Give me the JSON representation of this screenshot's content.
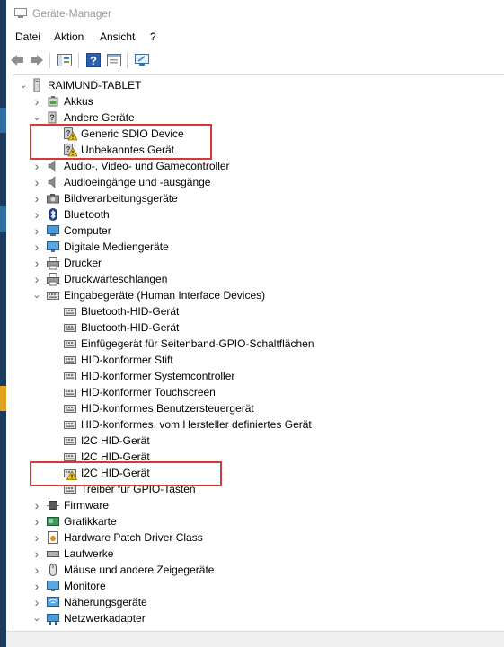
{
  "window": {
    "title": "Geräte-Manager"
  },
  "menu": [
    "Datei",
    "Aktion",
    "Ansicht",
    "?"
  ],
  "toolbar": [
    "back-icon",
    "forward-icon",
    "show-hide-tree-icon",
    "help-icon",
    "properties-icon",
    "monitor-icon"
  ],
  "colors": {
    "highlight": "#d23a3a",
    "chevron": "#666666",
    "warning": "#f2c200"
  },
  "tree": {
    "root": "RAIMUND-TABLET",
    "items": [
      {
        "label": "Akkus",
        "icon": "battery-icon",
        "level": 1,
        "expanded": false
      },
      {
        "label": "Andere Geräte",
        "icon": "other-devices-icon",
        "level": 1,
        "expanded": true
      },
      {
        "label": "Generic SDIO Device",
        "icon": "warning-device-icon",
        "level": 2
      },
      {
        "label": "Unbekanntes Gerät",
        "icon": "warning-device-icon",
        "level": 2
      },
      {
        "label": "Audio-, Video- und Gamecontroller",
        "icon": "speaker-icon",
        "level": 1,
        "expanded": false
      },
      {
        "label": "Audioeingänge und -ausgänge",
        "icon": "speaker-icon",
        "level": 1,
        "expanded": false
      },
      {
        "label": "Bildverarbeitungsgeräte",
        "icon": "camera-icon",
        "level": 1,
        "expanded": false
      },
      {
        "label": "Bluetooth",
        "icon": "bluetooth-icon",
        "level": 1,
        "expanded": false
      },
      {
        "label": "Computer",
        "icon": "computer-icon",
        "level": 1,
        "expanded": false
      },
      {
        "label": "Digitale Mediengeräte",
        "icon": "monitor-icon",
        "level": 1,
        "expanded": false
      },
      {
        "label": "Drucker",
        "icon": "printer-icon",
        "level": 1,
        "expanded": false
      },
      {
        "label": "Druckwarteschlangen",
        "icon": "printer-icon",
        "level": 1,
        "expanded": false
      },
      {
        "label": "Eingabegeräte (Human Interface Devices)",
        "icon": "hid-icon",
        "level": 1,
        "expanded": true
      },
      {
        "label": "Bluetooth-HID-Gerät",
        "icon": "hid-icon",
        "level": 2
      },
      {
        "label": "Bluetooth-HID-Gerät",
        "icon": "hid-icon",
        "level": 2
      },
      {
        "label": "Einfügegerät für Seitenband-GPIO-Schaltflächen",
        "icon": "hid-icon",
        "level": 2
      },
      {
        "label": "HID-konformer Stift",
        "icon": "hid-icon",
        "level": 2
      },
      {
        "label": "HID-konformer Systemcontroller",
        "icon": "hid-icon",
        "level": 2
      },
      {
        "label": "HID-konformer Touchscreen",
        "icon": "hid-icon",
        "level": 2
      },
      {
        "label": "HID-konformes Benutzersteuergerät",
        "icon": "hid-icon",
        "level": 2
      },
      {
        "label": "HID-konformes, vom Hersteller definiertes Gerät",
        "icon": "hid-icon",
        "level": 2
      },
      {
        "label": "I2C HID-Gerät",
        "icon": "hid-icon",
        "level": 2
      },
      {
        "label": "I2C HID-Gerät",
        "icon": "hid-icon",
        "level": 2
      },
      {
        "label": "I2C HID-Gerät",
        "icon": "warning-hid-icon",
        "level": 2
      },
      {
        "label": "Treiber für GPIO-Tasten",
        "icon": "hid-icon",
        "level": 2
      },
      {
        "label": "Firmware",
        "icon": "chip-icon",
        "level": 1,
        "expanded": false
      },
      {
        "label": "Grafikkarte",
        "icon": "display-adapter-icon",
        "level": 1,
        "expanded": false
      },
      {
        "label": "Hardware Patch Driver Class",
        "icon": "patch-icon",
        "level": 1,
        "expanded": false
      },
      {
        "label": "Laufwerke",
        "icon": "drive-icon",
        "level": 1,
        "expanded": false
      },
      {
        "label": "Mäuse und andere Zeigegeräte",
        "icon": "mouse-icon",
        "level": 1,
        "expanded": false
      },
      {
        "label": "Monitore",
        "icon": "monitor-icon",
        "level": 1,
        "expanded": false
      },
      {
        "label": "Näherungsgeräte",
        "icon": "proximity-icon",
        "level": 1,
        "expanded": false
      },
      {
        "label": "Netzwerkadapter",
        "icon": "network-icon",
        "level": 1,
        "expanded": true
      }
    ]
  }
}
